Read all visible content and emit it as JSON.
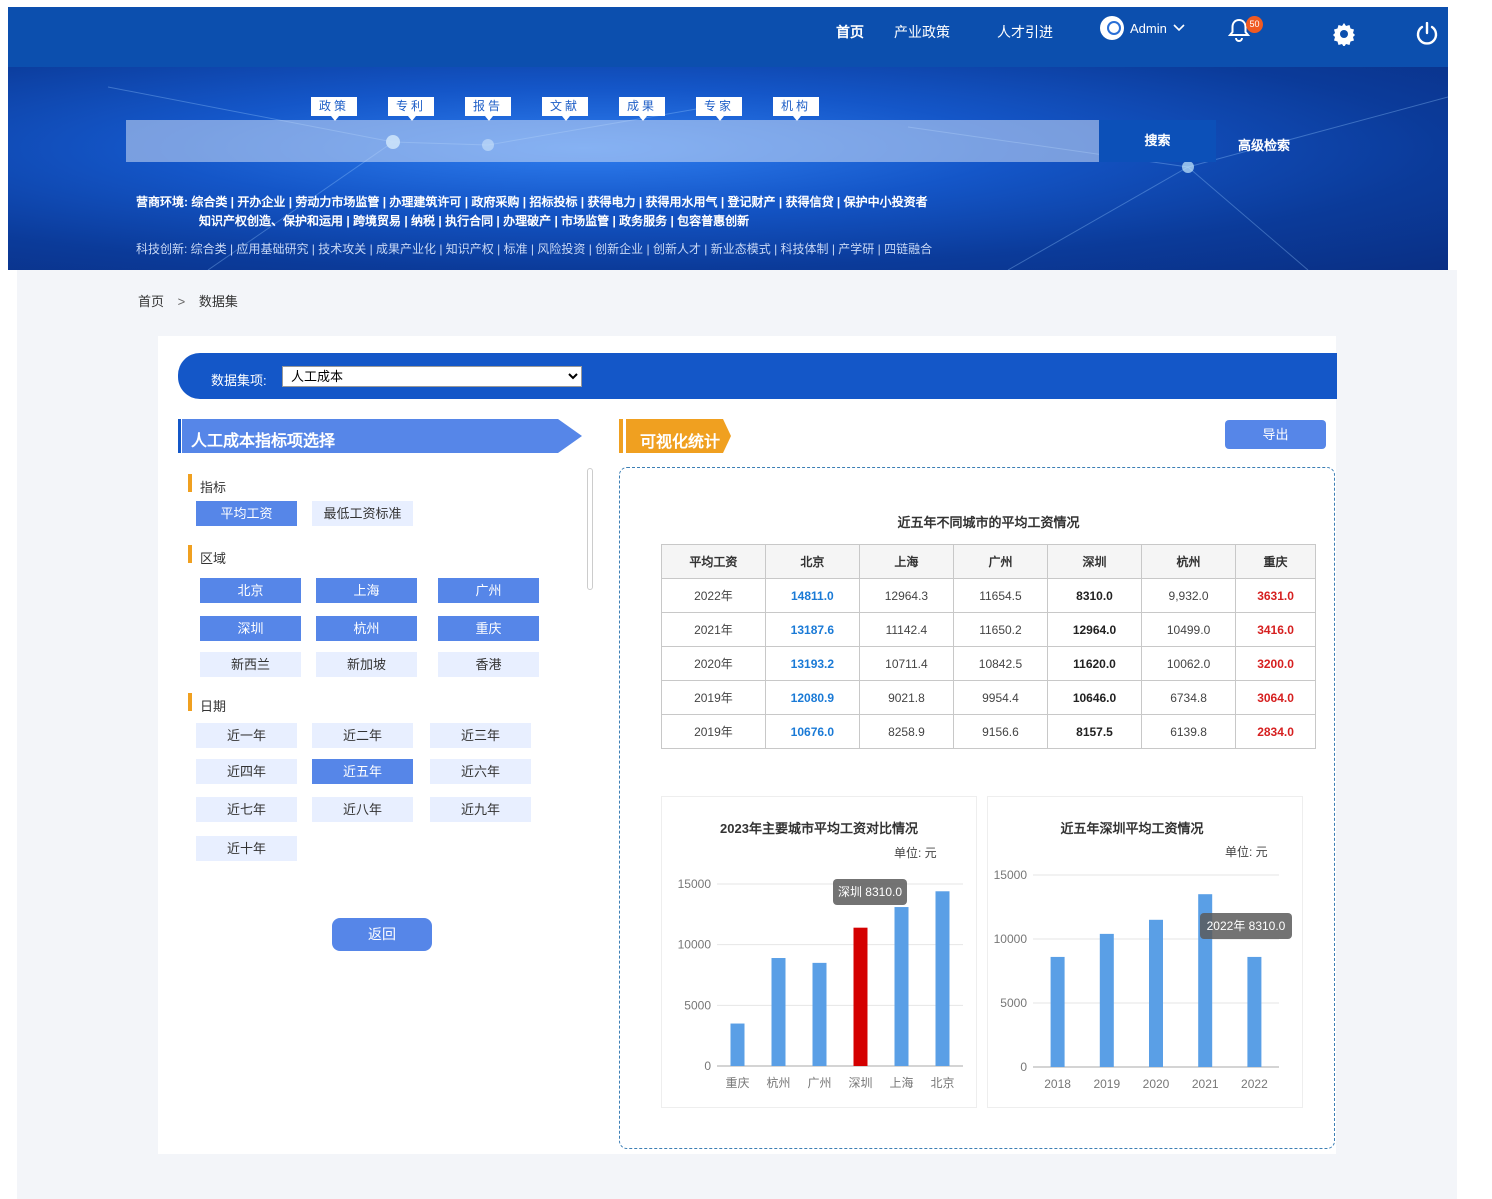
{
  "nav": {
    "items": [
      "首页",
      "产业政策",
      "人才引进"
    ],
    "user": "Admin",
    "notifications": "50"
  },
  "search": {
    "tabs": [
      "政策",
      "专利",
      "报告",
      "文献",
      "成果",
      "专家",
      "机构"
    ],
    "button": "搜索",
    "advanced": "高级检索"
  },
  "environment": {
    "line1": "营商环境:  综合类  |  开办企业  |  劳动力市场监管  |  办理建筑许可  |  政府采购  |  招标投标  |  获得电力  |  获得用水用气  |  登记财产  |  获得信贷  |  保护中小投资者",
    "line2": "知识产权创造、保护和运用  |  跨境贸易  |  纳税  |  执行合同  |  办理破产  |  市场监管  |  政务服务  |  包容普惠创新",
    "line3": "科技创新:  综合类  |  应用基础研究  |  技术攻关  |  成果产业化  |  知识产权  |  标准  |  风险投资  |  创新企业  |  创新人才  |  新业态模式  |  科技体制  |  产学研  |  四链融合"
  },
  "breadcrumb": {
    "home": "首页",
    "current": "数据集"
  },
  "dataset": {
    "label": "数据集项:",
    "selected": "人工成本"
  },
  "left": {
    "title": "人工成本指标项选择",
    "indicator": {
      "label": "指标",
      "items": [
        "平均工资",
        "最低工资标准"
      ],
      "active": [
        0
      ]
    },
    "region": {
      "label": "区域",
      "items": [
        "北京",
        "上海",
        "广州",
        "深圳",
        "杭州",
        "重庆",
        "新西兰",
        "新加坡",
        "香港"
      ],
      "active": [
        0,
        1,
        2,
        3,
        4,
        5
      ]
    },
    "date": {
      "label": "日期",
      "items": [
        "近一年",
        "近二年",
        "近三年",
        "近四年",
        "近五年",
        "近六年",
        "近七年",
        "近八年",
        "近九年",
        "近十年"
      ],
      "active": [
        4
      ]
    },
    "back": "返回"
  },
  "viz": {
    "title": "可视化统计",
    "export": "导出",
    "table_title": "近五年不同城市的平均工资情况",
    "headers": [
      "平均工资",
      "北京",
      "上海",
      "广州",
      "深圳",
      "杭州",
      "重庆"
    ],
    "rows": [
      [
        "2022年",
        "14811.0",
        "12964.3",
        "11654.5",
        "8310.0",
        "9,932.0",
        "3631.0"
      ],
      [
        "2021年",
        "13187.6",
        "11142.4",
        "11650.2",
        "12964.0",
        "10499.0",
        "3416.0"
      ],
      [
        "2020年",
        "13193.2",
        "10711.4",
        "10842.5",
        "11620.0",
        "10062.0",
        "3200.0"
      ],
      [
        "2019年",
        "12080.9",
        "9021.8",
        "9954.4",
        "10646.0",
        "6734.8",
        "3064.0"
      ],
      [
        "2019年",
        "10676.0",
        "8258.9",
        "9156.6",
        "8157.5",
        "6139.8",
        "2834.0"
      ]
    ]
  },
  "chart_data": [
    {
      "type": "bar",
      "title": "2023年主要城市平均工资对比情况",
      "unit": "单位: 元",
      "categories": [
        "重庆",
        "杭州",
        "广州",
        "深圳",
        "上海",
        "北京"
      ],
      "values": [
        3500,
        8900,
        8500,
        11400,
        13100,
        14400
      ],
      "highlight_index": 3,
      "highlight_color": "#d40000",
      "bar_color": "#5a9fe6",
      "yticks": [
        0,
        5000,
        10000,
        15000
      ],
      "ylim": [
        0,
        15000
      ],
      "tooltip": "深圳  8310.0"
    },
    {
      "type": "bar",
      "title": "近五年深圳平均工资情况",
      "unit": "单位: 元",
      "categories": [
        "2018",
        "2019",
        "2020",
        "2021",
        "2022"
      ],
      "values": [
        8600,
        10400,
        11500,
        13500,
        8600
      ],
      "bar_color": "#5a9fe6",
      "yticks": [
        0,
        5000,
        10000,
        15000
      ],
      "ylim": [
        0,
        15000
      ],
      "tooltip": "2022年   8310.0"
    }
  ]
}
